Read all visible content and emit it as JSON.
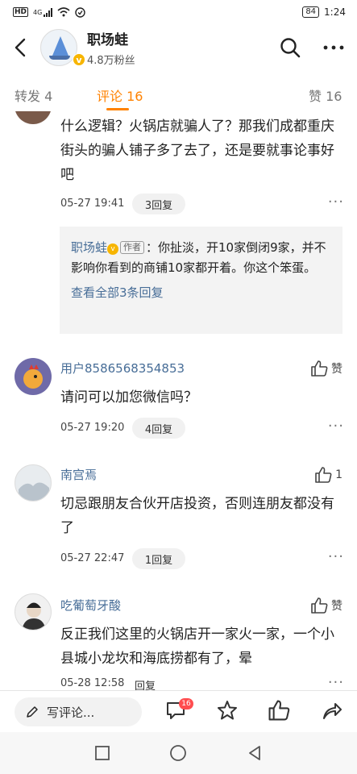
{
  "status": {
    "net": "4G",
    "hd": "HD",
    "battery": "84",
    "time": "1:24"
  },
  "header": {
    "title": "职场蛙",
    "followers": "4.8万粉丝"
  },
  "tabs": {
    "repost": "转发 4",
    "comments": "评论 16",
    "likes": "赞 16"
  },
  "comments": [
    {
      "text": "什么逻辑？火锅店就骗人了？那我们成都重庆街头的骗人铺子多了去了，还是要就事论事好吧",
      "date": "05-27 19:41",
      "replies": "3回复",
      "reply_preview": {
        "name": "职场蛙",
        "tag": "作者",
        "text": "：你扯淡，开10家倒闭9家，并不影响你看到的商铺10家都开着。你这个笨蛋。",
        "view_all": "查看全部3条回复"
      }
    },
    {
      "name": "用户8586568354853",
      "text": "请问可以加您微信吗？",
      "date": "05-27 19:20",
      "replies": "4回复",
      "like": "赞"
    },
    {
      "name": "南宫焉",
      "text": "切忌跟朋友合伙开店投资，否则连朋友都没有了",
      "date": "05-27 22:47",
      "replies": "1回复",
      "like": "1"
    },
    {
      "name": "吃葡萄牙酸",
      "text": "反正我们这里的火锅店开一家火一家，一个小县城小龙坎和海底捞都有了，晕",
      "date": "05-28 12:58",
      "replies": "回复",
      "like": "赞"
    }
  ],
  "bottom": {
    "write": "写评论...",
    "comment_count": "16"
  },
  "colors": {
    "accent": "#ff8200",
    "link": "#476d97",
    "badge": "#ff4d4f"
  }
}
